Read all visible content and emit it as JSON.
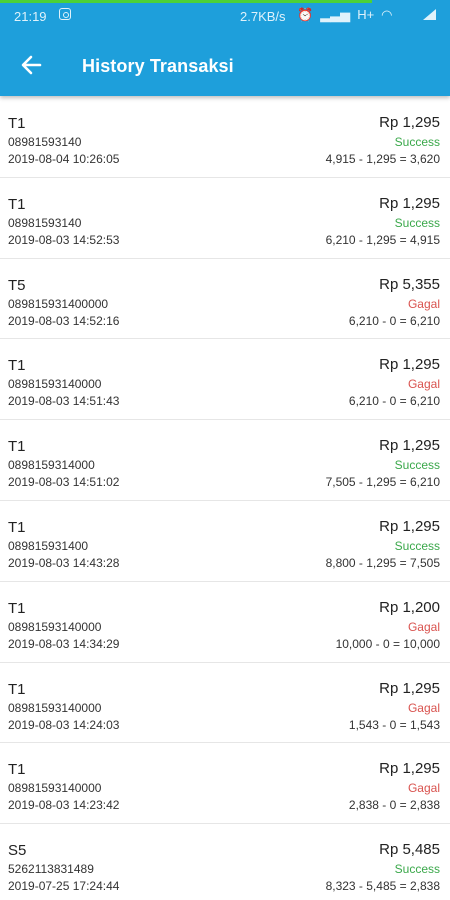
{
  "status_bar": {
    "time": "21:19",
    "speed": "2.7KB/s",
    "icons": [
      "alarm-icon",
      "signal-icon",
      "network-H-icon",
      "wifi-icon",
      "battery-icon"
    ]
  },
  "header": {
    "title": "History Transaksi",
    "color": "#1e9fdb"
  },
  "transactions": [
    {
      "code": "T1",
      "phone": "08981593140",
      "datetime": "2019-08-04 10:26:05",
      "amount": "Rp 1,295",
      "status": "Success",
      "calc": "4,915 - 1,295 = 3,620"
    },
    {
      "code": "T1",
      "phone": "08981593140",
      "datetime": "2019-08-03 14:52:53",
      "amount": "Rp 1,295",
      "status": "Success",
      "calc": "6,210 - 1,295 = 4,915"
    },
    {
      "code": "T5",
      "phone": "089815931400000",
      "datetime": "2019-08-03 14:52:16",
      "amount": "Rp 5,355",
      "status": "Gagal",
      "calc": "6,210 - 0 = 6,210"
    },
    {
      "code": "T1",
      "phone": "08981593140000",
      "datetime": "2019-08-03 14:51:43",
      "amount": "Rp 1,295",
      "status": "Gagal",
      "calc": "6,210 - 0 = 6,210"
    },
    {
      "code": "T1",
      "phone": "0898159314000",
      "datetime": "2019-08-03 14:51:02",
      "amount": "Rp 1,295",
      "status": "Success",
      "calc": "7,505 - 1,295 = 6,210"
    },
    {
      "code": "T1",
      "phone": "089815931400",
      "datetime": "2019-08-03 14:43:28",
      "amount": "Rp 1,295",
      "status": "Success",
      "calc": "8,800 - 1,295 = 7,505"
    },
    {
      "code": "T1",
      "phone": "08981593140000",
      "datetime": "2019-08-03 14:34:29",
      "amount": "Rp 1,200",
      "status": "Gagal",
      "calc": "10,000 - 0 = 10,000"
    },
    {
      "code": "T1",
      "phone": "08981593140000",
      "datetime": "2019-08-03 14:24:03",
      "amount": "Rp 1,295",
      "status": "Gagal",
      "calc": "1,543 - 0 = 1,543"
    },
    {
      "code": "T1",
      "phone": "08981593140000",
      "datetime": "2019-08-03 14:23:42",
      "amount": "Rp 1,295",
      "status": "Gagal",
      "calc": "2,838 - 0 = 2,838"
    },
    {
      "code": "S5",
      "phone": "5262113831489",
      "datetime": "2019-07-25 17:24:44",
      "amount": "Rp 5,485",
      "status": "Success",
      "calc": "8,323 - 5,485 = 2,838"
    }
  ],
  "status_colors": {
    "Success": "#3aa84a",
    "Gagal": "#d9534f"
  }
}
